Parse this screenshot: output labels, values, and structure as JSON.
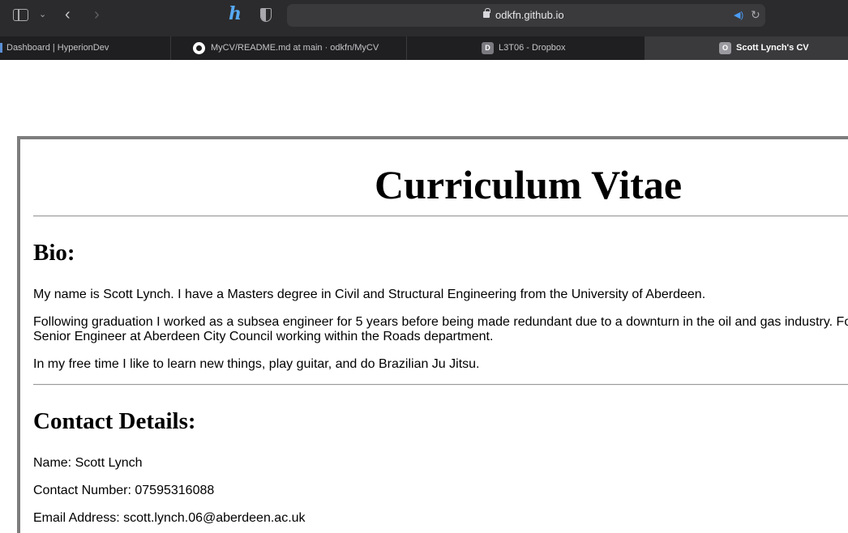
{
  "browser": {
    "url": "odkfn.github.io",
    "icons": [
      "sidebar-icon",
      "chevron-down-icon",
      "back-icon",
      "forward-icon",
      "h-extension-icon",
      "shield-icon",
      "lock-icon",
      "speaker-icon",
      "reload-icon"
    ]
  },
  "tabs": [
    {
      "label": "Dashboard | HyperionDev",
      "active": false
    },
    {
      "label": "MyCV/README.md at main · odkfn/MyCV",
      "active": false,
      "favicon": "github-icon"
    },
    {
      "label": "L3T06 - Dropbox",
      "active": false,
      "favicon_letter": "D"
    },
    {
      "label": "Scott Lynch's CV",
      "active": true,
      "favicon_letter": "O"
    }
  ],
  "page": {
    "title": "Curriculum Vitae",
    "bio_heading": "Bio:",
    "bio_p1": "My name is Scott Lynch. I have a Masters degree in Civil and Structural Engineering from the University of Aberdeen.",
    "bio_p2_line1": "Following graduation I worked as a subsea engineer for 5 years before being made redundant due to a downturn in the oil and gas industry. Fo",
    "bio_p2_line2": "Senior Engineer at Aberdeen City Council working within the Roads department.",
    "bio_p3": "In my free time I like to learn new things, play guitar, and do Brazilian Ju Jitsu.",
    "contact_heading": "Contact Details:",
    "contact_name": "Name: Scott Lynch",
    "contact_number": "Contact Number: 07595316088",
    "contact_email": "Email Address: scott.lynch.06@aberdeen.ac.uk"
  }
}
